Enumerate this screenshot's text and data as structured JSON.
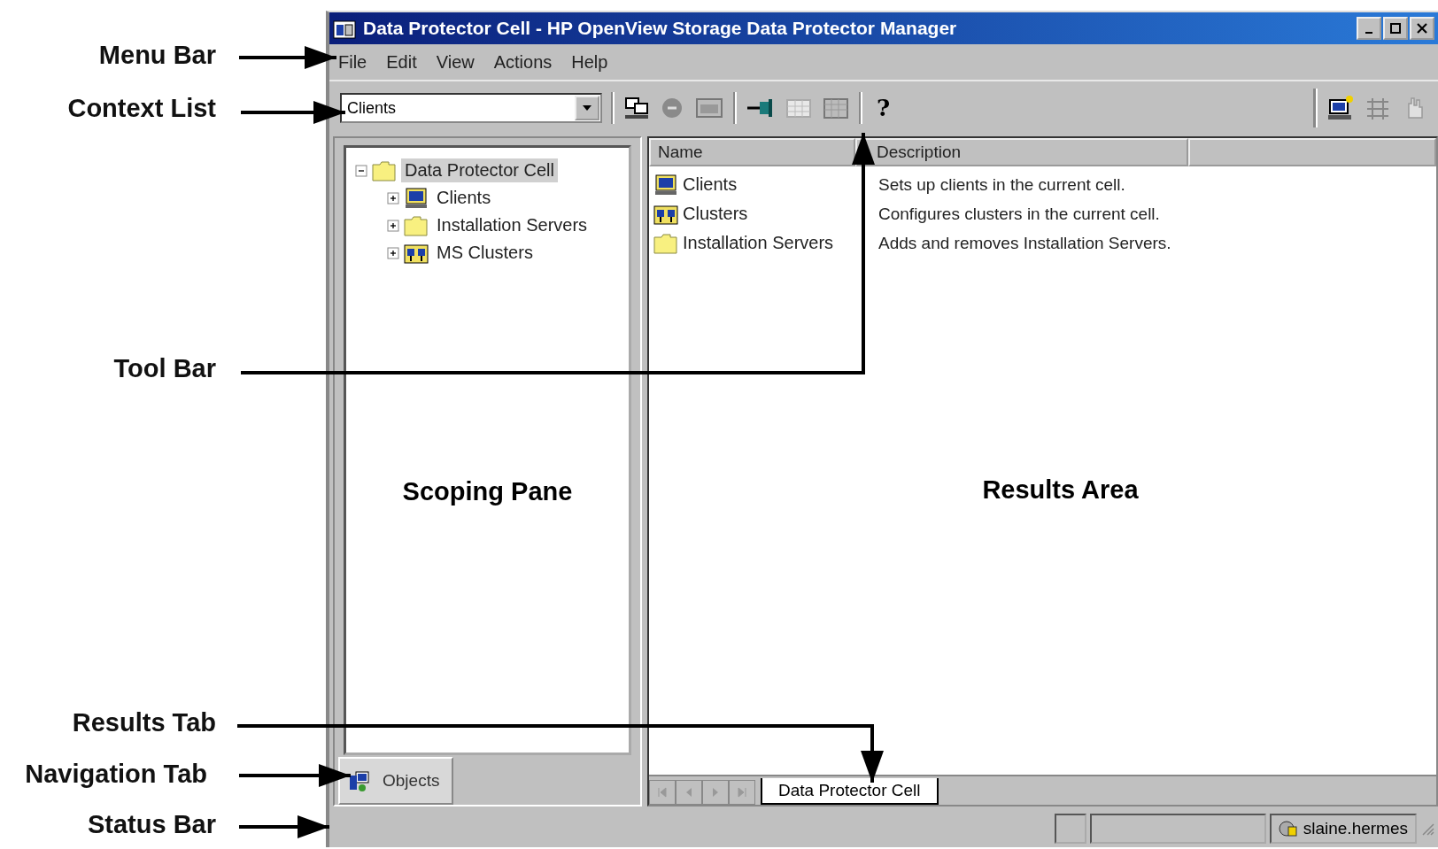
{
  "annotations": [
    {
      "label": "Menu Bar"
    },
    {
      "label": "Context List"
    },
    {
      "label": "Tool Bar"
    },
    {
      "label": "Results Tab"
    },
    {
      "label": "Navigation Tab"
    },
    {
      "label": "Status Bar"
    }
  ],
  "window": {
    "title": "Data Protector Cell - HP OpenView Storage Data Protector Manager"
  },
  "menu": [
    "File",
    "Edit",
    "View",
    "Actions",
    "Help"
  ],
  "context_list": {
    "value": "Clients"
  },
  "toolbar": {
    "help": "?"
  },
  "tree": [
    {
      "label": "Data Protector Cell",
      "kind": "folder-open",
      "expanded": true,
      "selected": true,
      "children": [
        {
          "label": "Clients",
          "kind": "computer",
          "expanded": false,
          "selected": false
        },
        {
          "label": "Installation Servers",
          "kind": "folder",
          "expanded": false,
          "selected": false
        },
        {
          "label": "MS Clusters",
          "kind": "cluster",
          "expanded": false,
          "selected": false
        }
      ]
    }
  ],
  "pane_labels": {
    "scoping": "Scoping Pane",
    "results": "Results Area"
  },
  "results": {
    "columns": [
      "Name",
      "Description"
    ],
    "rows": [
      {
        "name": "Clients",
        "kind": "computer",
        "description": "Sets up clients in the current cell."
      },
      {
        "name": "Clusters",
        "kind": "cluster",
        "description": "Configures clusters in the current cell."
      },
      {
        "name": "Installation Servers",
        "kind": "folder",
        "description": "Adds and removes Installation Servers."
      }
    ]
  },
  "nav_tabs": [
    {
      "label": "Objects",
      "selected": true
    }
  ],
  "result_tabs": [
    {
      "label": "Data Protector Cell",
      "selected": true
    }
  ],
  "status_bar": {
    "user": "slaine.hermes"
  }
}
